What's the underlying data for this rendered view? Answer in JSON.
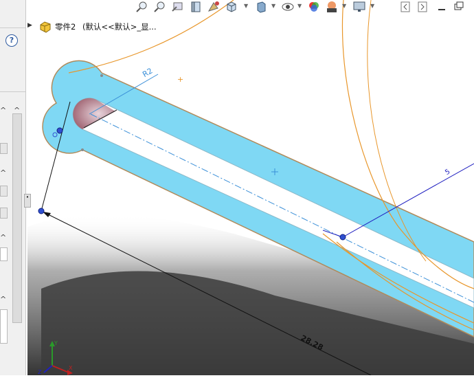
{
  "tree": {
    "part_name": "零件2",
    "config_text": "(默认<<默认>_显..."
  },
  "help_icon_glyph": "?",
  "dimensions": {
    "length": "28.28",
    "radius": "R2",
    "small": "5"
  },
  "triad": {
    "x": "X",
    "y": "Y",
    "z": "Z"
  },
  "colors": {
    "slot_fill": "#7fd8f4",
    "slot_edge": "#b08a5a",
    "sketch_orange": "#e8962a",
    "sketch_blue": "#2020c0",
    "dim_blue": "#3a8fd8",
    "shadow": "#3a3a3a"
  },
  "toolbar_icons": [
    "zoom-to-fit-icon",
    "zoom-area-icon",
    "previous-view-icon",
    "section-view-icon",
    "dynamic-annotation-icon",
    "view-orientation-icon",
    "display-style-icon",
    "hide-show-icon",
    "edit-appearance-icon",
    "scene-icon",
    "display-settings-icon",
    "minimize-window-icon",
    "restore-window-icon"
  ]
}
